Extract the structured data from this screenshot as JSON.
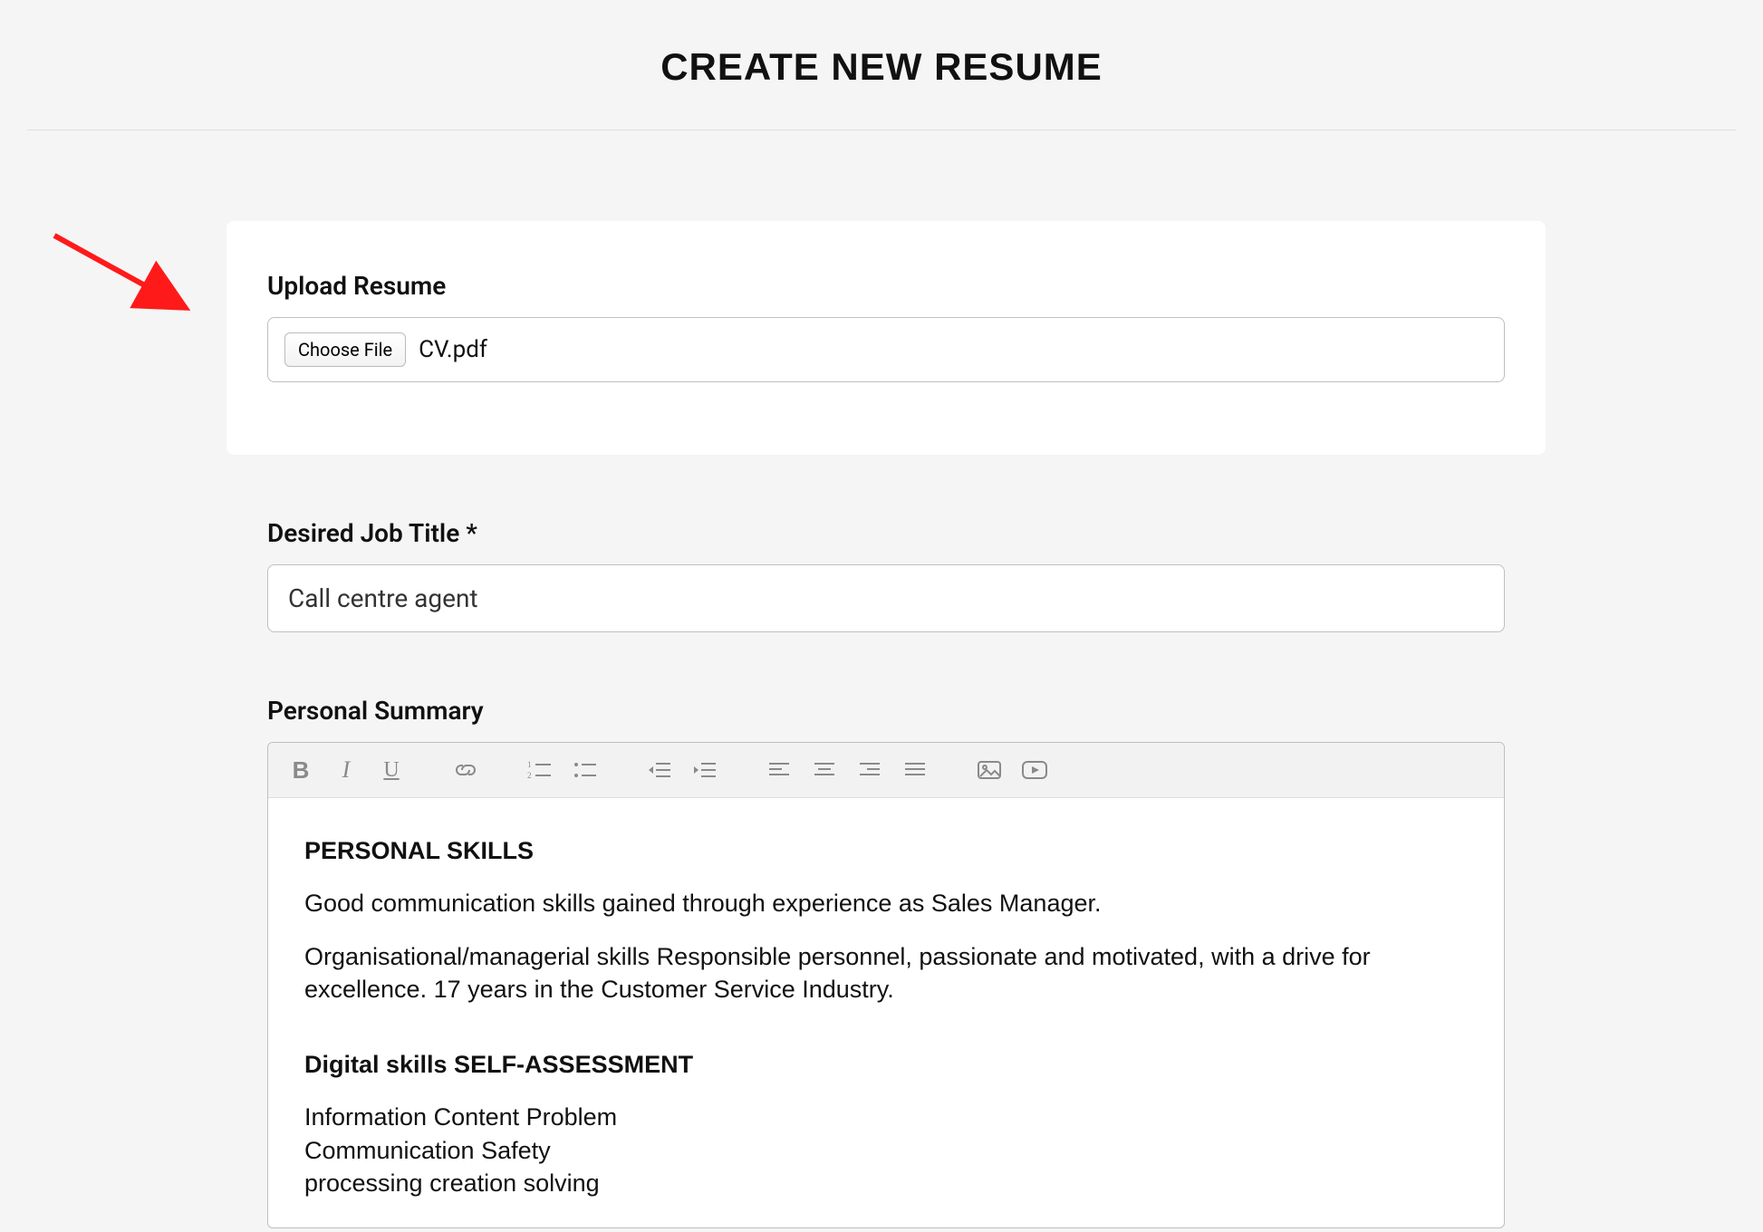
{
  "header": {
    "title": "CREATE NEW RESUME"
  },
  "upload": {
    "label": "Upload Resume",
    "button_label": "Choose File",
    "filename": "CV.pdf"
  },
  "job_title": {
    "label": "Desired Job Title *",
    "value": "Call centre agent"
  },
  "summary": {
    "label": "Personal Summary",
    "toolbar": {
      "bold": "B",
      "italic": "I",
      "underline": "U"
    },
    "content": {
      "heading1": "PERSONAL SKILLS",
      "p1": "Good communication skills gained through experience as Sales Manager.",
      "p2": "Organisational/managerial skills Responsible personnel, passionate and motivated, with a drive for excellence. 17 years in the Customer Service Industry.",
      "heading2": "Digital skills SELF-ASSESSMENT",
      "line1": "Information Content Problem",
      "line2": "Communication Safety",
      "line3": "processing creation solving"
    }
  }
}
